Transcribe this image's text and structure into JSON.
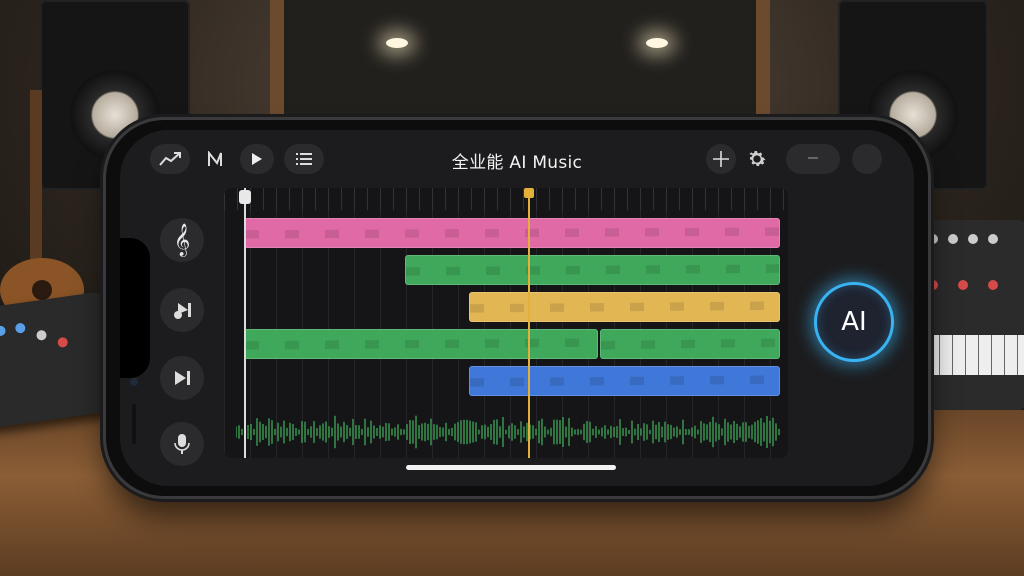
{
  "app": {
    "title": "全业能 AI Music",
    "ai_button_label": "AI"
  },
  "toolbar": {
    "left_icons": [
      "trend-icon",
      "beat-icon",
      "play-icon",
      "list-icon"
    ],
    "right_icons": [
      "crosshair-icon",
      "gear-icon",
      "minimize-icon",
      "circle-icon"
    ]
  },
  "sidebar": {
    "items": [
      {
        "icon": "treble-clef-icon"
      },
      {
        "icon": "skip-next-icon"
      },
      {
        "icon": "play-next-icon"
      },
      {
        "icon": "microphone-icon"
      }
    ]
  },
  "tracks": [
    {
      "name": "track-1",
      "color": "#e06aa6",
      "clips": [
        {
          "start": 0.0,
          "end": 1.0
        }
      ]
    },
    {
      "name": "track-2",
      "color": "#3fa85a",
      "clips": [
        {
          "start": 0.3,
          "end": 1.0
        }
      ]
    },
    {
      "name": "track-3",
      "color": "#e3b654",
      "clips": [
        {
          "start": 0.42,
          "end": 1.0
        }
      ]
    },
    {
      "name": "track-4",
      "color": "#3fa85a",
      "clips": [
        {
          "start": 0.0,
          "end": 0.66
        },
        {
          "start": 0.66,
          "end": 1.0
        }
      ]
    },
    {
      "name": "track-5",
      "color": "#3f78d8",
      "clips": [
        {
          "start": 0.42,
          "end": 1.0
        }
      ]
    }
  ],
  "playhead": {
    "position": 0.53,
    "color": "#e3b13a"
  },
  "start_marker": {
    "position": 0.0
  },
  "colors": {
    "accent": "#3ab3f3",
    "waveform": "#3fa85a"
  }
}
